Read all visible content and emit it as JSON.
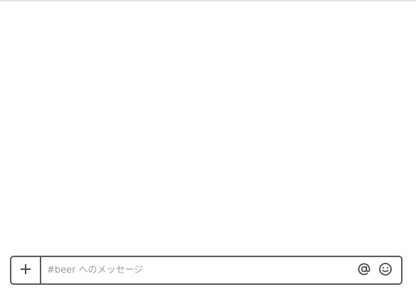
{
  "composer": {
    "placeholder": "#beer へのメッセージ",
    "value": ""
  },
  "icons": {
    "attach": "plus-icon",
    "mention": "at-sign-icon",
    "emoji": "smiley-icon"
  },
  "colors": {
    "border": "#5a5a5a",
    "placeholder": "#9a9a9a",
    "icon": "#4a4a4a"
  }
}
